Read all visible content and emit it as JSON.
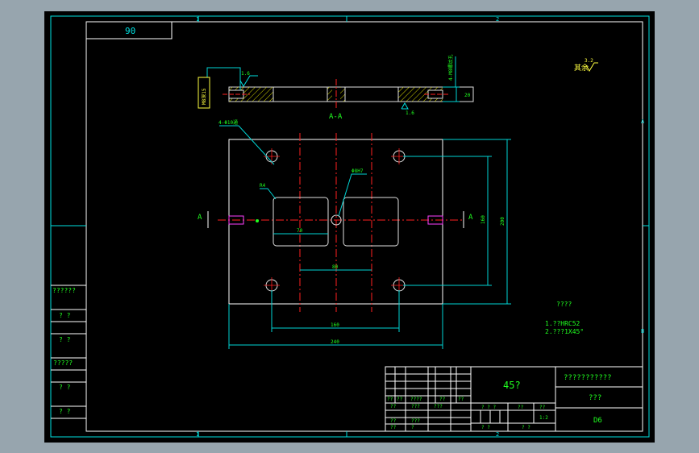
{
  "colors": {
    "background": "#000000",
    "frame": "#ffffff",
    "border": "#00e0e0",
    "dimension": "#00d4d4",
    "centerline": "#ff2020",
    "text_green": "#20ff20",
    "text_yellow": "#ffff40",
    "hole": "#e0e0e0",
    "pink": "#ff40ff",
    "hatch": "#d8d800",
    "outer_bg": "#97a5ae"
  },
  "sheet": {
    "zone_marks_top": [
      "1",
      "2"
    ],
    "zone_marks_bottom": [
      "1",
      "2"
    ],
    "zone_marks_right": [
      "A",
      "B"
    ],
    "corner_box_text": "90"
  },
  "section_view": {
    "label": "A-A",
    "roughness_left": "1.6",
    "roughness_right": "1.6",
    "thread_label": "M8深15",
    "vertical_note": "4-M8螺纹孔",
    "height_dim": "20"
  },
  "surface_note": {
    "label": "其余",
    "value": "3.2"
  },
  "plan_view": {
    "holes_callout": "4-Φ10通",
    "slot_radius": "R4",
    "center_hole_callout": "Φ8H7",
    "section_left": "A",
    "section_right": "A",
    "dim_slot_width": "70",
    "dim_center_spacing": "80",
    "dim_hole_spacing": "160",
    "dim_overall_width": "240",
    "dim_right_inner": "160",
    "dim_right_outer": "200"
  },
  "tech_notes": {
    "title": "????",
    "line1": "1.??HRC52",
    "line2": "2.???1X45°"
  },
  "left_strip": {
    "rows": [
      "??????",
      "? ?",
      "? ?",
      "?????",
      "? ?",
      "? ?"
    ]
  },
  "title_block": {
    "material": "45?",
    "company": "???????????",
    "drawing_name": "???",
    "drawing_number": "D6",
    "row_labels_a": [
      "??",
      "??",
      "????",
      "??",
      "??"
    ],
    "row_labels_b": [
      "??",
      "???",
      "???"
    ],
    "row_labels_c": [
      "??",
      "???"
    ],
    "row_labels_d": [
      "??",
      "?"
    ],
    "stage_label": "? ? ?",
    "weight_label": "??",
    "scale_label": "??",
    "scale_value": "1:2",
    "sheet_label": "?  ?",
    "sheet_of_label": "?  ?"
  }
}
